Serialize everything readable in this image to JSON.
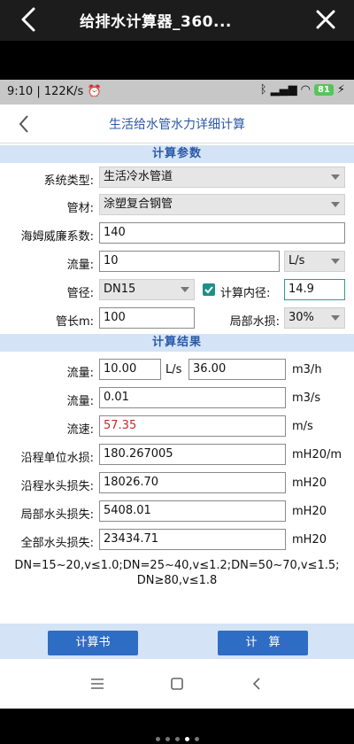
{
  "outer": {
    "title": "给排水计算器_360..."
  },
  "status": {
    "time_speed": "9:10 | 122K/s",
    "battery": "81"
  },
  "nav": {
    "title": "生活给水管水力详细计算"
  },
  "params": {
    "header": "计算参数",
    "system_type_label": "系统类型:",
    "system_type_value": "生活冷水管道",
    "material_label": "管材:",
    "material_value": "涂塑复合钢管",
    "hazen_label": "海姆威廉系数:",
    "hazen_value": "140",
    "flow_label": "流量:",
    "flow_value": "10",
    "flow_unit": "L/s",
    "diameter_label": "管径:",
    "diameter_value": "DN15",
    "inner_check_label": "计算内径:",
    "inner_value": "14.9",
    "length_label": "管长m:",
    "length_value": "100",
    "local_loss_label": "局部水损:",
    "local_loss_value": "30%"
  },
  "results": {
    "header": "计算结果",
    "flow1_label": "流量:",
    "flow1_value": "10.00",
    "flow1_unit": "L/s",
    "flow1_value2": "36.00",
    "flow1_unit2": "m3/h",
    "flow2_label": "流量:",
    "flow2_value": "0.01",
    "flow2_unit": "m3/s",
    "velocity_label": "流速:",
    "velocity_value": "57.35",
    "velocity_unit": "m/s",
    "unit_loss_label": "沿程单位水损:",
    "unit_loss_value": "180.267005",
    "unit_loss_unit": "mH20/m",
    "head_loss_label": "沿程水头损失:",
    "head_loss_value": "18026.70",
    "head_loss_unit": "mH20",
    "local_head_label": "局部水头损失:",
    "local_head_value": "5408.01",
    "local_head_unit": "mH20",
    "total_head_label": "全部水头损失:",
    "total_head_value": "23434.71",
    "total_head_unit": "mH20"
  },
  "note": {
    "line1": "DN=15~20,v≤1.0;DN=25~40,v≤1.2;DN=50~70,v≤1.5;",
    "line2": "DN≥80,v≤1.8"
  },
  "buttons": {
    "report": "计算书",
    "calculate": "计　算"
  },
  "colors": {
    "accent": "#2e6dc4",
    "section_bg": "#d4e4f6",
    "velocity_text": "#c62828",
    "checkbox": "#1e8f8a"
  }
}
